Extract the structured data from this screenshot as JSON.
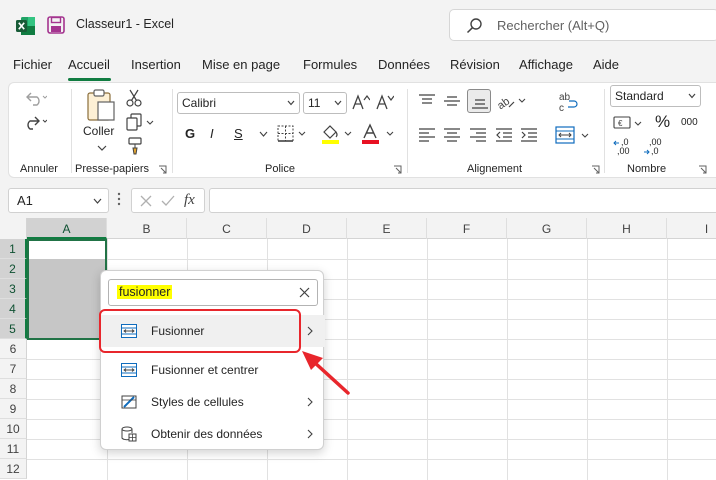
{
  "titlebar": {
    "title": "Classeur1  -  Excel",
    "search_placeholder": "Rechercher (Alt+Q)"
  },
  "tabs": [
    "Fichier",
    "Accueil",
    "Insertion",
    "Mise en page",
    "Formules",
    "Données",
    "Révision",
    "Affichage",
    "Aide"
  ],
  "active_tab": "Accueil",
  "ribbon": {
    "groups": {
      "annuler": "Annuler",
      "presse_papiers": "Presse-papiers",
      "police": "Police",
      "alignement": "Alignement",
      "nombre": "Nombre"
    },
    "coller_label": "Coller",
    "font_name": "Calibri",
    "font_size": "11",
    "bold": "G",
    "italic": "I",
    "underline": "S",
    "number_format": "Standard",
    "percent": "%",
    "thousands": "000",
    "dec_increase": ",00",
    "dec_increase_2": ",0",
    "dec_decrease": ",00",
    "dec_decrease_2": ",0"
  },
  "formula_bar": {
    "name_box": "A1",
    "fx": "fx",
    "formula": ""
  },
  "grid": {
    "columns": [
      "A",
      "B",
      "C",
      "D",
      "E",
      "F",
      "G",
      "H",
      "I"
    ],
    "rows": [
      "1",
      "2",
      "3",
      "4",
      "5",
      "6",
      "7",
      "8",
      "9",
      "10",
      "11",
      "12"
    ],
    "selected_range": "A1:A5"
  },
  "popup": {
    "search_value": "fusionner",
    "items": [
      {
        "label": "Fusionner",
        "has_submenu": true,
        "icon": "merge-icon"
      },
      {
        "label": "Fusionner et centrer",
        "has_submenu": false,
        "icon": "merge-center-icon"
      },
      {
        "label": "Styles de cellules",
        "has_submenu": true,
        "icon": "cell-styles-icon"
      },
      {
        "label": "Obtenir des données",
        "has_submenu": true,
        "icon": "get-data-icon"
      }
    ]
  },
  "colors": {
    "excel_green": "#107c41",
    "highlight": "#ffff00",
    "annotation_red": "#e8262c",
    "save_purple": "#a4348f"
  }
}
